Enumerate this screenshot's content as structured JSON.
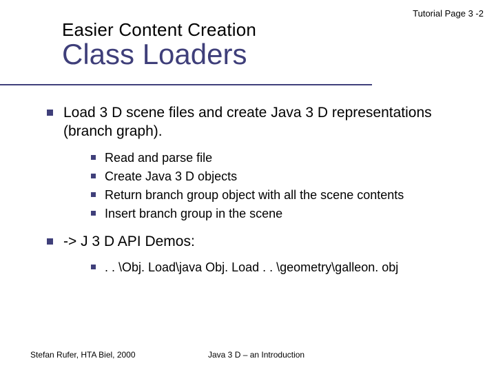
{
  "page_label": "Tutorial Page 3 -2",
  "header": {
    "subtitle": "Easier Content Creation",
    "title": "Class Loaders"
  },
  "bullets": [
    {
      "text": "Load 3 D scene files and create Java 3 D representations (branch graph).",
      "children": [
        "Read and parse file",
        "Create Java 3 D objects",
        "Return branch group object with all the scene contents",
        "Insert branch group in the scene"
      ]
    },
    {
      "text": "-> J 3 D API Demos:",
      "children": [
        ". . \\Obj. Load\\java Obj. Load . . \\geometry\\galleon. obj"
      ]
    }
  ],
  "footer": {
    "author": "Stefan Rufer, HTA Biel, 2000",
    "doc_title": "Java 3 D – an Introduction"
  }
}
